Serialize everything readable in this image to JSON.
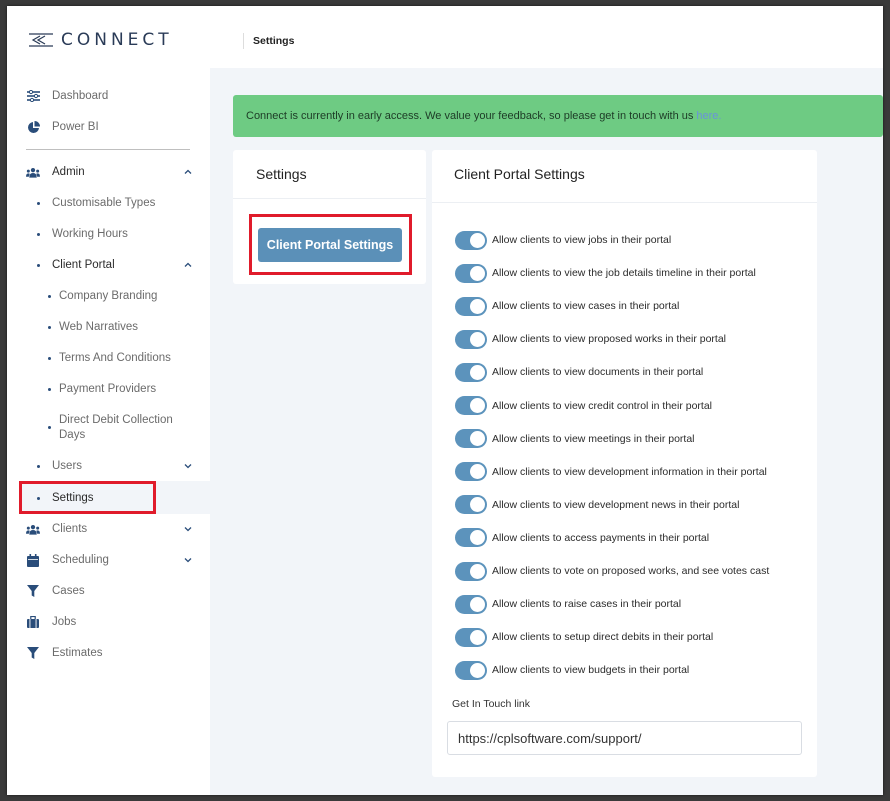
{
  "brand": {
    "name": "CONNECT"
  },
  "topbar": {
    "title": "Settings"
  },
  "sidebar": {
    "dashboard": "Dashboard",
    "power_bi": "Power BI",
    "admin": "Admin",
    "customisable_types": "Customisable Types",
    "working_hours": "Working Hours",
    "client_portal": "Client Portal",
    "company_branding": "Company Branding",
    "web_narratives": "Web Narratives",
    "terms_and_conditions": "Terms And Conditions",
    "payment_providers": "Payment Providers",
    "direct_debit_line1": "Direct Debit Collection",
    "direct_debit_line2": "Days",
    "users": "Users",
    "settings": "Settings",
    "clients": "Clients",
    "scheduling": "Scheduling",
    "cases": "Cases",
    "jobs": "Jobs",
    "estimates": "Estimates"
  },
  "banner": {
    "text": "Connect is currently in early access. We value your feedback, so please get in touch with us",
    "link": "here."
  },
  "left_card": {
    "title": "Settings",
    "button": "Client Portal Settings"
  },
  "right_card": {
    "title": "Client Portal Settings",
    "toggles": [
      {
        "label": "Allow clients to view jobs in their portal",
        "on": true
      },
      {
        "label": "Allow clients to view the job details timeline in their portal",
        "on": true
      },
      {
        "label": "Allow clients to view cases in their portal",
        "on": true
      },
      {
        "label": "Allow clients to view proposed works in their portal",
        "on": true
      },
      {
        "label": "Allow clients to view documents in their portal",
        "on": true
      },
      {
        "label": "Allow clients to view credit control in their portal",
        "on": true
      },
      {
        "label": "Allow clients to view meetings in their portal",
        "on": true
      },
      {
        "label": "Allow clients to view development information in their portal",
        "on": true
      },
      {
        "label": "Allow clients to view development news in their portal",
        "on": true
      },
      {
        "label": "Allow clients to access payments in their portal",
        "on": true
      },
      {
        "label": "Allow clients to vote on proposed works, and see votes cast",
        "on": true
      },
      {
        "label": "Allow clients to raise cases in their portal",
        "on": true
      },
      {
        "label": "Allow clients to setup direct debits in their portal",
        "on": true
      },
      {
        "label": "Allow clients to view budgets in their portal",
        "on": true
      }
    ],
    "get_in_touch_label": "Get In Touch link",
    "get_in_touch_value": "https://cplsoftware.com/support/"
  },
  "colors": {
    "accent": "#5b90b8",
    "banner": "#6ecb83",
    "highlight": "#e01b2b",
    "nav_icon": "#2a4d7a"
  }
}
